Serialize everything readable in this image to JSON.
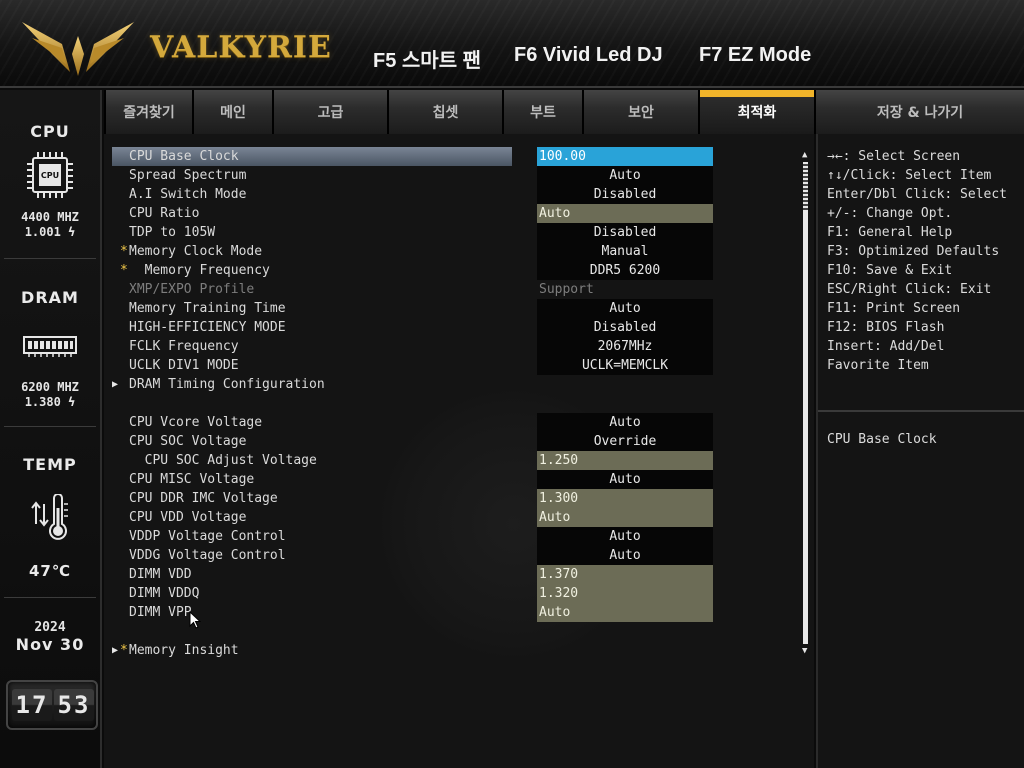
{
  "header": {
    "brand": "VALKYRIE",
    "fkeys": [
      {
        "label": "F5 스마트 팬"
      },
      {
        "label": "F6 Vivid Led DJ"
      },
      {
        "label": "F7 EZ Mode"
      }
    ]
  },
  "sidebar": {
    "cpu": {
      "title": "CPU",
      "chip_label": "CPU",
      "freq": "4400 MHZ",
      "volt": "1.001 ϟ"
    },
    "dram": {
      "title": "DRAM",
      "freq": "6200 MHZ",
      "volt": "1.380 ϟ"
    },
    "temp": {
      "title": "TEMP",
      "value": "47℃"
    },
    "date": {
      "year": "2024",
      "day": "Nov 30"
    },
    "clock": {
      "hours": "17",
      "minutes": "53"
    }
  },
  "tabs": [
    {
      "label": "즐겨찾기"
    },
    {
      "label": "메인"
    },
    {
      "label": "고급"
    },
    {
      "label": "칩셋"
    },
    {
      "label": "부트"
    },
    {
      "label": "보안"
    },
    {
      "label": "최적화",
      "active": true
    },
    {
      "label": "저장 & 나가기"
    }
  ],
  "settings": [
    {
      "label": "CPU Base Clock",
      "value": "100.00",
      "style": "sel",
      "selected": true
    },
    {
      "label": "Spread Spectrum",
      "value": "Auto",
      "style": "box"
    },
    {
      "label": "A.I Switch Mode",
      "value": "Disabled",
      "style": "box"
    },
    {
      "label": "CPU Ratio",
      "value": "Auto",
      "style": "input"
    },
    {
      "label": "TDP to 105W",
      "value": "Disabled",
      "style": "box"
    },
    {
      "label": "Memory Clock Mode",
      "value": "Manual",
      "style": "box",
      "star": "*"
    },
    {
      "label": "  Memory Frequency",
      "value": "DDR5 6200",
      "style": "box",
      "star": "*"
    },
    {
      "label": "XMP/EXPO Profile",
      "value": "Support",
      "style": "plain",
      "dim": true
    },
    {
      "label": "Memory Training Time",
      "value": "Auto",
      "style": "box"
    },
    {
      "label": "HIGH-EFFICIENCY MODE",
      "value": "Disabled",
      "style": "box"
    },
    {
      "label": "FCLK Frequency",
      "value": "2067MHz",
      "style": "box"
    },
    {
      "label": "UCLK DIV1 MODE",
      "value": "UCLK=MEMCLK",
      "style": "box"
    },
    {
      "label": "DRAM Timing Configuration",
      "value": "",
      "style": "none",
      "submenu": true
    },
    {
      "label": "",
      "value": "",
      "style": "none"
    },
    {
      "label": "CPU Vcore Voltage",
      "value": "Auto",
      "style": "box"
    },
    {
      "label": "CPU SOC Voltage",
      "value": "Override",
      "style": "box"
    },
    {
      "label": "  CPU SOC Adjust Voltage",
      "value": "1.250",
      "style": "input"
    },
    {
      "label": "CPU MISC Voltage",
      "value": "Auto",
      "style": "box"
    },
    {
      "label": "CPU DDR IMC Voltage",
      "value": "1.300",
      "style": "input"
    },
    {
      "label": "CPU VDD Voltage",
      "value": "Auto",
      "style": "input"
    },
    {
      "label": "VDDP Voltage Control",
      "value": "Auto",
      "style": "box"
    },
    {
      "label": "VDDG Voltage Control",
      "value": "Auto",
      "style": "box"
    },
    {
      "label": "DIMM VDD",
      "value": "1.370",
      "style": "input"
    },
    {
      "label": "DIMM VDDQ",
      "value": "1.320",
      "style": "input"
    },
    {
      "label": "DIMM VPP",
      "value": "Auto",
      "style": "input"
    },
    {
      "label": "",
      "value": "",
      "style": "none"
    },
    {
      "label": "Memory Insight",
      "value": "",
      "style": "none",
      "submenu": true,
      "star": "*"
    }
  ],
  "help": {
    "keys": [
      "→←: Select Screen",
      "↑↓/Click: Select Item",
      "Enter/Dbl Click: Select",
      "+/-: Change Opt.",
      "F1: General Help",
      "F3: Optimized Defaults",
      "F10: Save & Exit",
      "ESC/Right Click: Exit",
      "F11: Print Screen",
      "F12: BIOS Flash",
      "Insert: Add/Del",
      "Favorite Item"
    ],
    "description": "CPU Base Clock"
  },
  "colors": {
    "accent": "#f1b42a",
    "selected_value": "#29a3d8",
    "input_value": "#6c6c56",
    "brand_gold": "#d4a93c"
  }
}
